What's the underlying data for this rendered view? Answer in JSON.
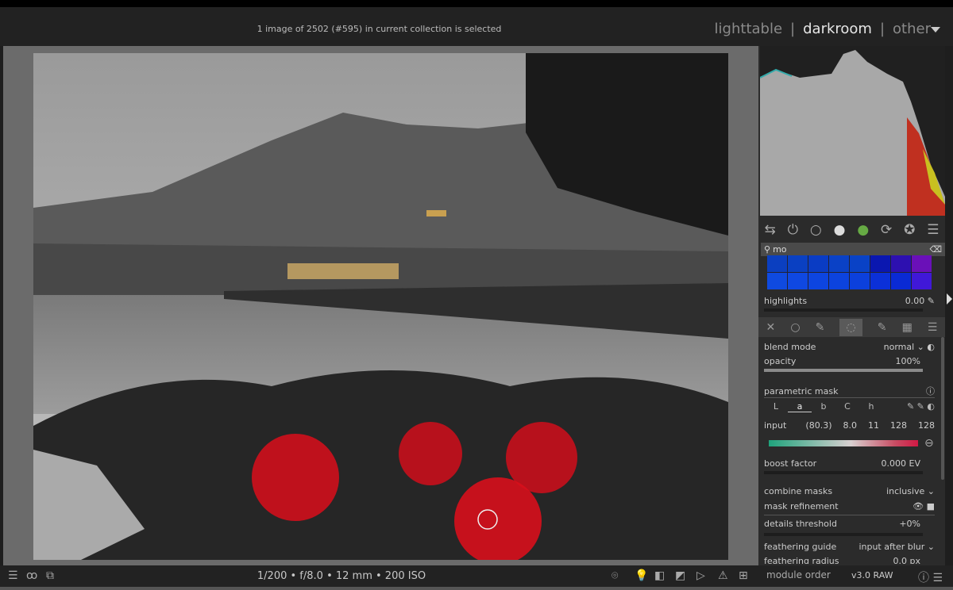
{
  "header": {
    "selection_info": "1 image of 2502 (#595) in current collection is selected",
    "views": [
      {
        "label": "lighttable",
        "active": false
      },
      {
        "label": "darkroom",
        "active": true
      },
      {
        "label": "other",
        "active": false
      }
    ],
    "separator": "|"
  },
  "module_icons": [
    "presets-icon",
    "power-icon",
    "circle-icon",
    "sphere-icon",
    "color-wheel-icon",
    "refresh-icon",
    "star-badge-icon",
    "menu-icon"
  ],
  "search": {
    "value": "mo"
  },
  "color_grid": [
    "#0b3fc0",
    "#0a40c2",
    "#0a3cc4",
    "#0a41c6",
    "#0942c6",
    "#0a17b0",
    "#2d10b0",
    "#6a10b8",
    "#0f4ae0",
    "#0f48e2",
    "#0d45e0",
    "#0c43de",
    "#0c40dc",
    "#0b30d8",
    "#0a2ad4",
    "#4018d8"
  ],
  "highlights": {
    "label": "highlights",
    "value": "0.00"
  },
  "blend_tabs": [
    "off-icon",
    "uniform-icon",
    "drawn-mask-icon",
    "parametric-mask-icon",
    "drawn-parametric-icon",
    "raster-mask-icon",
    "menu-icon"
  ],
  "blend": {
    "blend_mode": {
      "label": "blend mode",
      "value": "normal"
    },
    "opacity": {
      "label": "opacity",
      "value": "100%",
      "percent": 100
    },
    "parametric_mask": "parametric mask",
    "channels": [
      "L",
      "a",
      "b",
      "C",
      "h"
    ],
    "active_channel": "a",
    "input": {
      "label": "input",
      "values": [
        "(80.3)",
        "8.0",
        "11",
        "128",
        "128"
      ]
    },
    "boost_factor": {
      "label": "boost factor",
      "value": "0.000 EV"
    },
    "combine_masks": {
      "label": "combine masks",
      "value": "inclusive"
    },
    "mask_refinement": "mask refinement",
    "details_threshold": {
      "label": "details threshold",
      "value": "+0%"
    },
    "feathering_guide": {
      "label": "feathering guide",
      "value": "input after blur"
    },
    "feathering_radius": {
      "label": "feathering radius",
      "value": "0.0 px"
    }
  },
  "module_order": {
    "label": "module order",
    "value": "v3.0 RAW"
  },
  "bottom": {
    "exif": "1/200 • f/8.0 • 12 mm • 200 ISO"
  }
}
